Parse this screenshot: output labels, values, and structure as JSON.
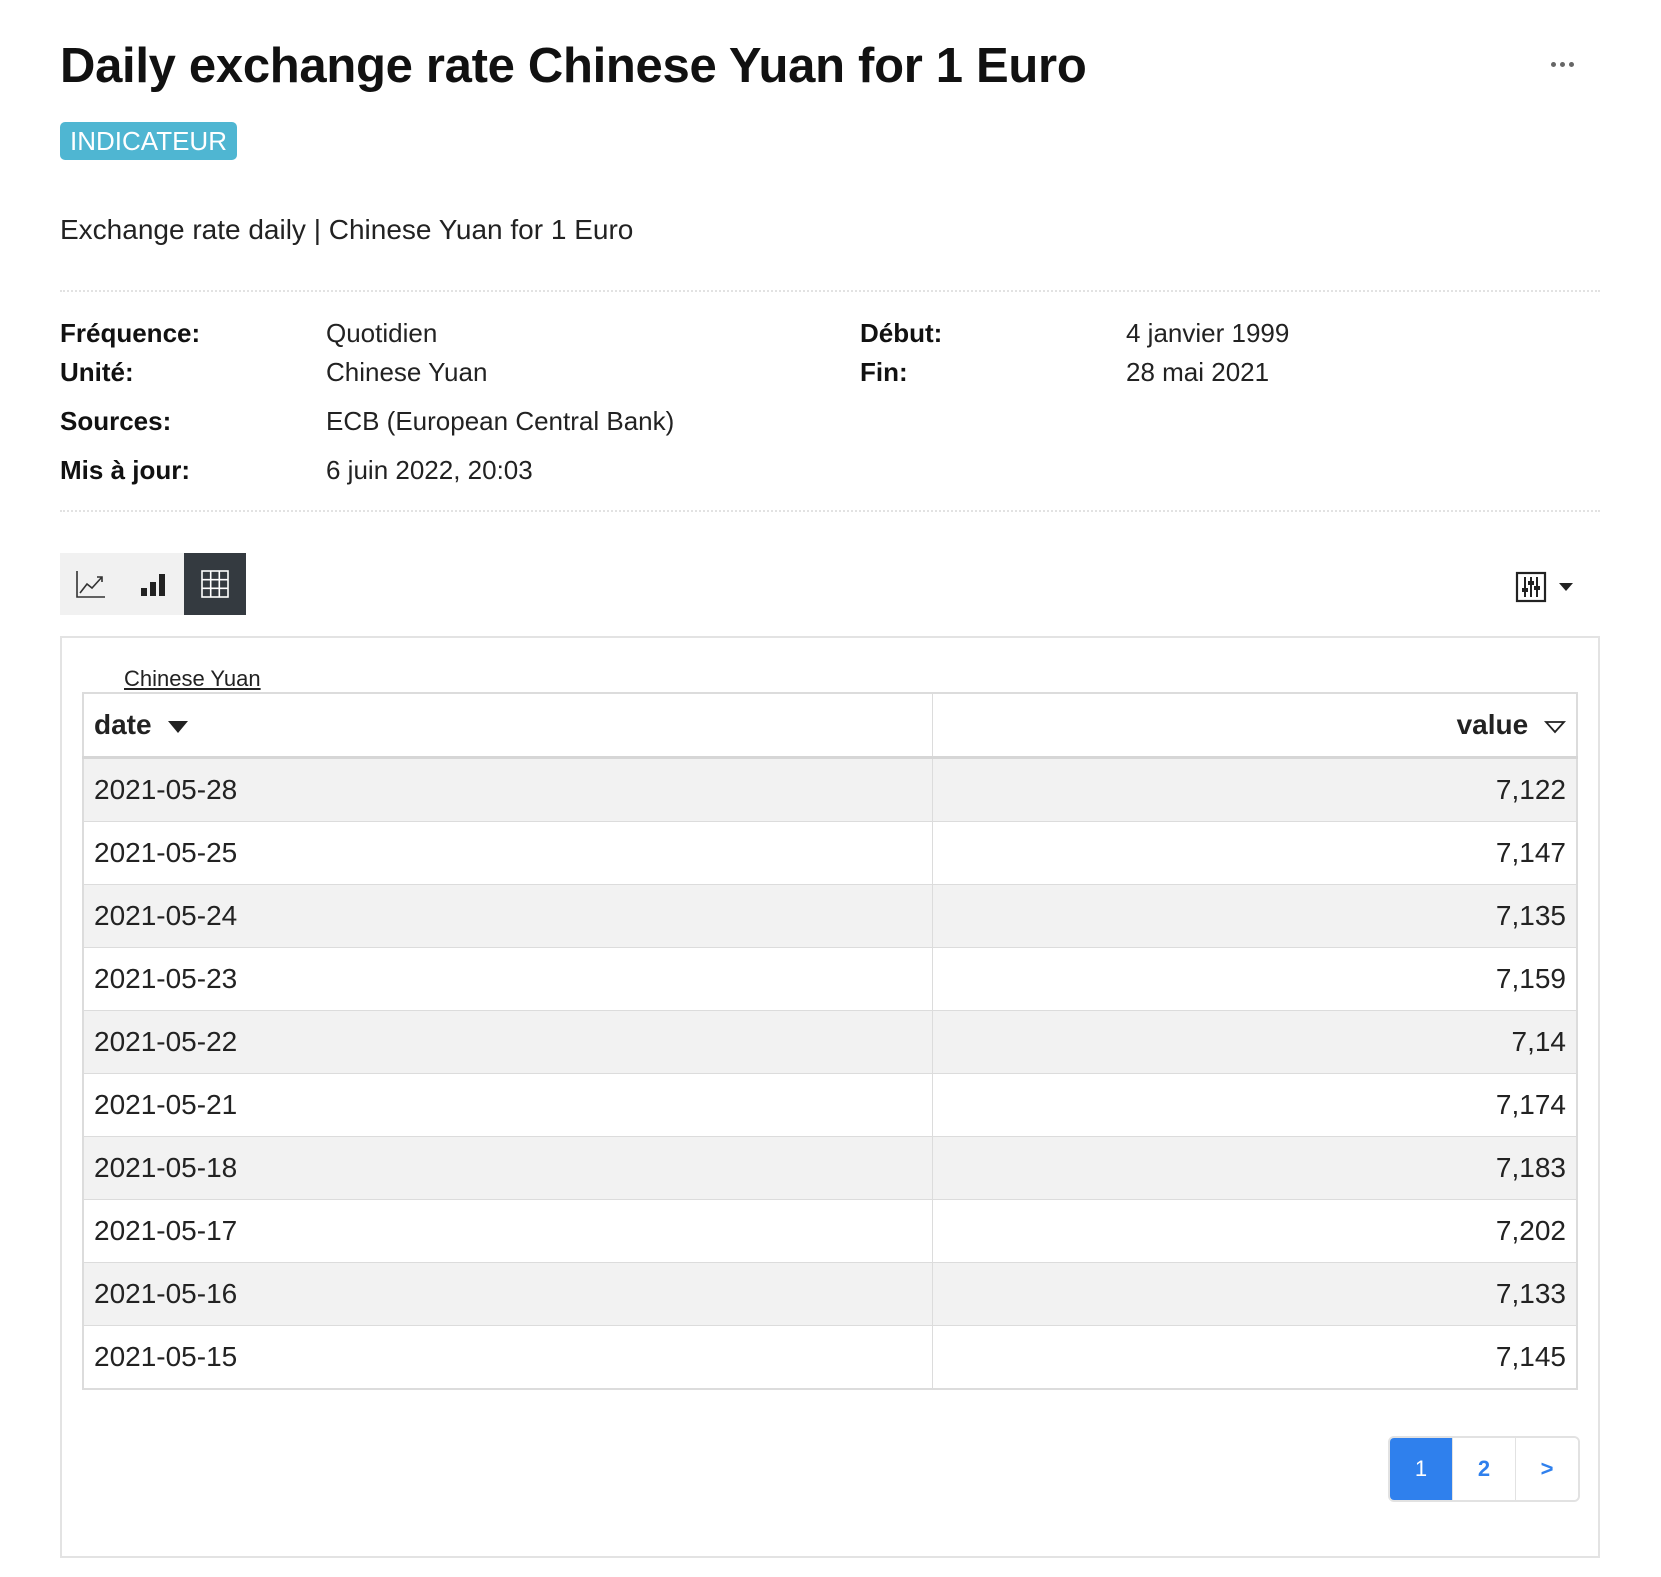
{
  "header": {
    "title": "Daily exchange rate Chinese Yuan for 1 Euro",
    "badge": "INDICATEUR",
    "subtitle": "Exchange rate daily | Chinese Yuan for 1 Euro",
    "more_icon": "more-horizontal-icon"
  },
  "meta": {
    "frequency_label": "Fréquence:",
    "frequency_value": "Quotidien",
    "unit_label": "Unité:",
    "unit_value": "Chinese Yuan",
    "sources_label": "Sources:",
    "sources_value": "ECB (European Central Bank)",
    "updated_label": "Mis à jour:",
    "updated_value": "6 juin 2022, 20:03",
    "start_label": "Début:",
    "start_value": "4 janvier 1999",
    "end_label": "Fin:",
    "end_value": "28 mai 2021"
  },
  "toolbar": {
    "views": [
      "line-chart-icon",
      "bar-chart-icon",
      "table-icon"
    ],
    "active_view": "table-icon",
    "settings_icon": "sliders-icon",
    "dropdown_icon": "caret-down-icon"
  },
  "table": {
    "series_label": "Chinese Yuan",
    "columns": [
      "date",
      "value"
    ],
    "rows": [
      {
        "date": "2021-05-28",
        "value": "7,122"
      },
      {
        "date": "2021-05-25",
        "value": "7,147"
      },
      {
        "date": "2021-05-24",
        "value": "7,135"
      },
      {
        "date": "2021-05-23",
        "value": "7,159"
      },
      {
        "date": "2021-05-22",
        "value": "7,14"
      },
      {
        "date": "2021-05-21",
        "value": "7,174"
      },
      {
        "date": "2021-05-18",
        "value": "7,183"
      },
      {
        "date": "2021-05-17",
        "value": "7,202"
      },
      {
        "date": "2021-05-16",
        "value": "7,133"
      },
      {
        "date": "2021-05-15",
        "value": "7,145"
      }
    ]
  },
  "pagination": {
    "pages": [
      "1",
      "2"
    ],
    "current": "1",
    "next_label": ">"
  },
  "colors": {
    "badge": "#4fb6d2",
    "active_view": "#343a40",
    "pagination_active": "#2f80ed"
  }
}
